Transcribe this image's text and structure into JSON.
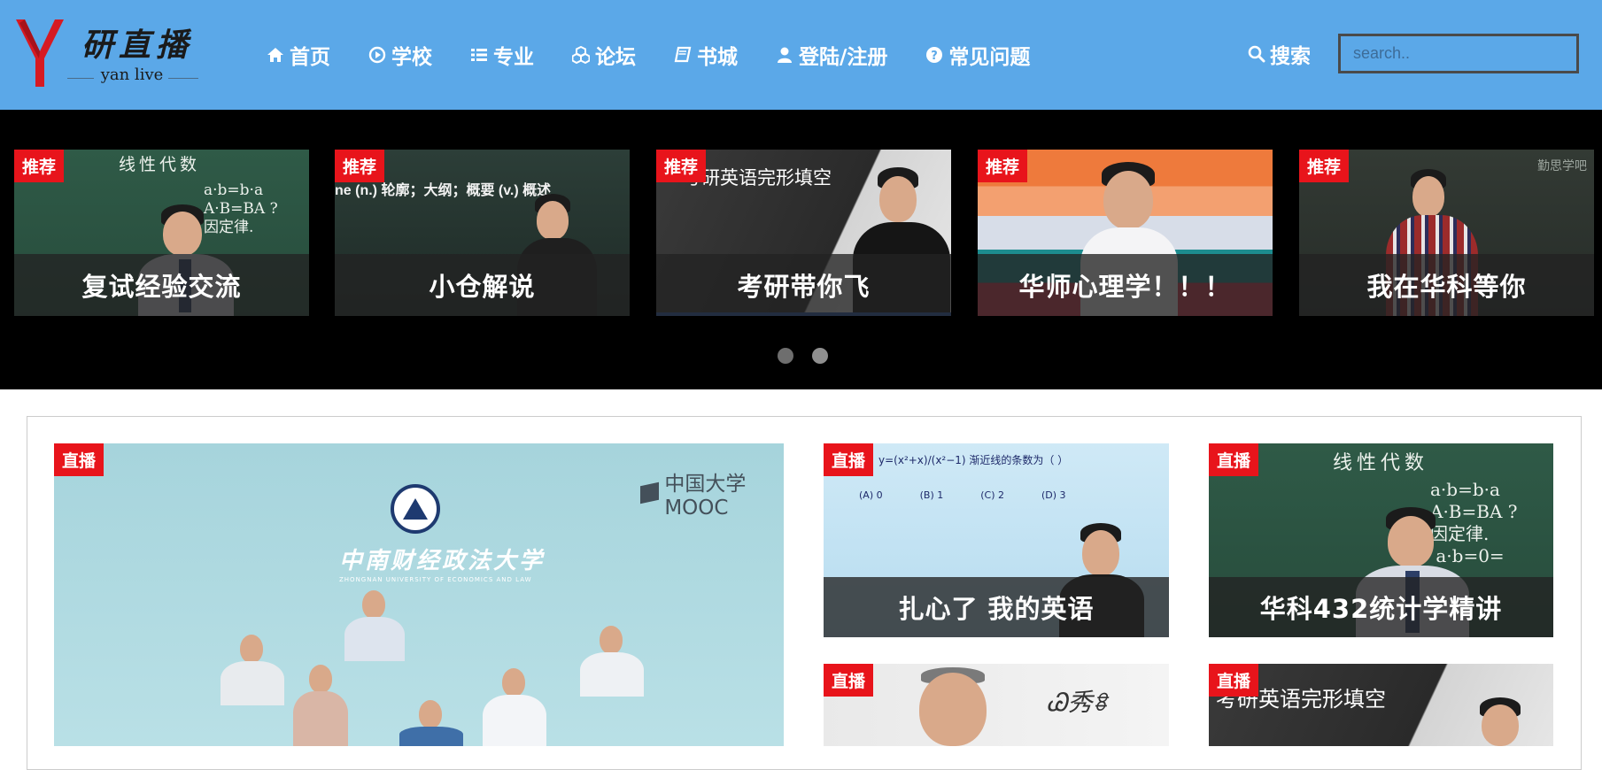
{
  "logo": {
    "cn": "研直播",
    "en": "yan live"
  },
  "nav": [
    {
      "label": "首页",
      "icon": "home-icon"
    },
    {
      "label": "学校",
      "icon": "play-circle-icon"
    },
    {
      "label": "专业",
      "icon": "list-icon"
    },
    {
      "label": "论坛",
      "icon": "cubes-icon"
    },
    {
      "label": "书城",
      "icon": "book-icon"
    },
    {
      "label": "登陆/注册",
      "icon": "user-icon"
    },
    {
      "label": "常见问题",
      "icon": "question-circle-icon"
    }
  ],
  "search": {
    "label": "搜索",
    "icon": "search-icon",
    "placeholder": "search.."
  },
  "carousel": {
    "badge": "推荐",
    "slides": [
      {
        "title": "复试经验交流",
        "board_text": "线性代数"
      },
      {
        "title": "小仓解说",
        "board_text": "ne (n.) 轮廓；大纲；概要 (v.) 概述"
      },
      {
        "title": "考研带你飞",
        "board_text": "考研英语完形填空"
      },
      {
        "title": "华师心理学！！！"
      },
      {
        "title": "我在华科等你",
        "watermark": "勤思学吧"
      }
    ],
    "active_dot": 0,
    "dot_count": 2
  },
  "live": {
    "badge": "直播",
    "featured": {
      "watermark": "中国大学MOOC",
      "university_cn": "中南财经政法大学",
      "university_en": "ZHONGNAN UNIVERSITY OF ECONOMICS AND LAW"
    },
    "cards": [
      {
        "title": "扎心了 我的英语",
        "board_text": "y=(x²+x)/(x²−1) 渐近线的条数为（ ）",
        "options": [
          "(A) 0",
          "(B) 1",
          "(C) 2",
          "(D) 3"
        ]
      },
      {
        "title": "华科432统计学精讲",
        "board_text": "线性代数"
      },
      {
        "title": ""
      },
      {
        "title": "",
        "board_text": "考研英语完形填空"
      }
    ]
  },
  "colors": {
    "header": "#5ba8e8",
    "badge": "#e8141b",
    "carousel_bg": "#000000"
  }
}
